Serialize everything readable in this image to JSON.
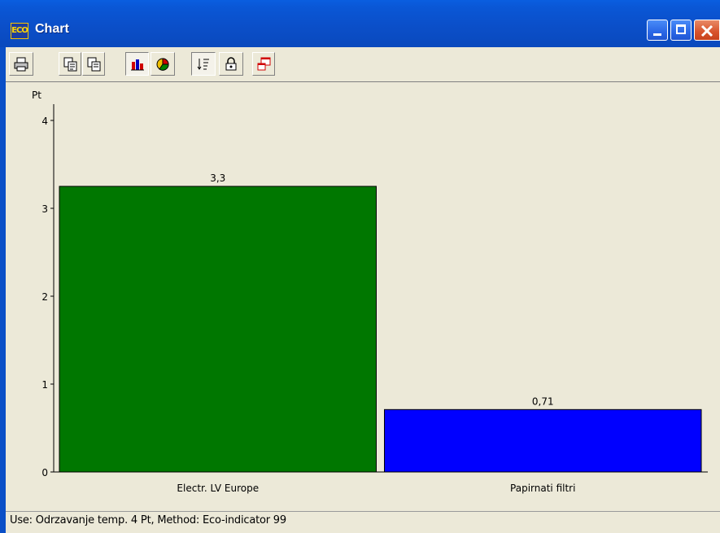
{
  "window": {
    "icon_text": "ECO",
    "title": "Chart"
  },
  "toolbar": {
    "buttons": [
      "printer-icon",
      "copy-icon",
      "copy-alt-icon",
      "bar-chart-icon",
      "pie-chart-icon",
      "sort-icon",
      "lock-icon",
      "window-icon"
    ]
  },
  "chart_data": {
    "type": "bar",
    "ylabel": "Pt",
    "ylim": [
      0,
      4
    ],
    "yticks": [
      "0",
      "1",
      "2",
      "3",
      "4"
    ],
    "categories": [
      "Electr. LV Europe",
      "Papirnati filtri"
    ],
    "values": [
      3.25,
      0.71
    ],
    "value_labels": [
      "3,3",
      "0,71"
    ],
    "colors": [
      "#007700",
      "#0000ff"
    ],
    "grid": false,
    "legend": "none"
  },
  "status": {
    "text": "Use:  Odrzavanje temp.  4 Pt,  Method: Eco-indicator 99"
  }
}
